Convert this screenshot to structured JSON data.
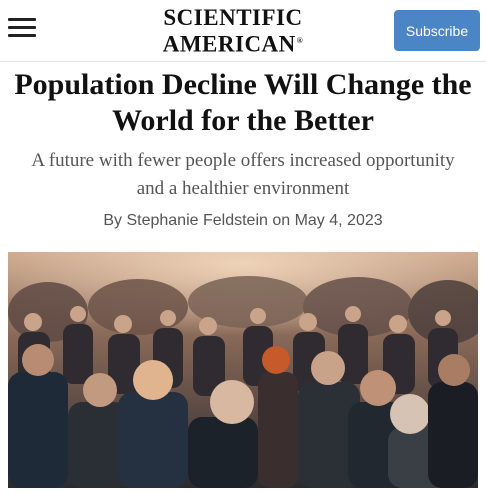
{
  "header": {
    "logo_line1": "SCIENTIFIC",
    "logo_line2": "AMERICAN",
    "logo_mark": "®",
    "subscribe_label": "Subscribe",
    "menu_icon": "hamburger-menu-icon"
  },
  "article": {
    "headline": "Population Decline Will Change the World for the Better",
    "dek": "A future with fewer people offers increased opportunity and a healthier environment",
    "byline": "By Stephanie Feldstein on May 4, 2023"
  },
  "colors": {
    "subscribe_bg": "#4a86c5",
    "dek_text": "#555555"
  }
}
